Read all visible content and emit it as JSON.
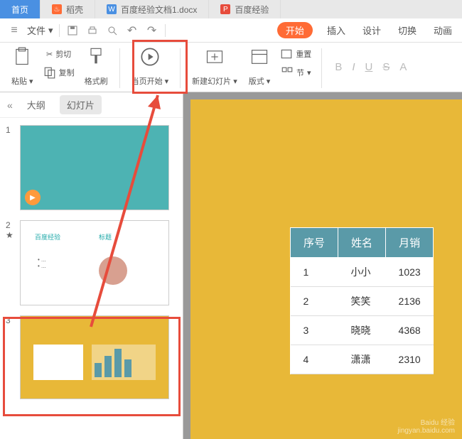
{
  "tabs": {
    "home": "首页",
    "daoke": "稻壳",
    "doc": "百度经验文档1.docx",
    "ppt": "百度经验"
  },
  "file_menu": "文件",
  "ribbon_menu": {
    "start": "开始",
    "insert": "插入",
    "design": "设计",
    "transition": "切换",
    "animation": "动画"
  },
  "ribbon": {
    "cut": "剪切",
    "paste": "粘贴",
    "copy": "复制",
    "format": "格式刷",
    "slideshow": "当页开始",
    "new_slide": "新建幻灯片",
    "layout": "版式",
    "section": "节",
    "reset": "重置"
  },
  "sidebar": {
    "outline": "大纲",
    "slides": "幻灯片"
  },
  "thumb_nums": [
    "1",
    "2",
    "3"
  ],
  "table": {
    "headers": [
      "序号",
      "姓名",
      "月销"
    ],
    "rows": [
      [
        "1",
        "小小",
        "1023"
      ],
      [
        "2",
        "笑笑",
        "2136"
      ],
      [
        "3",
        "晓晓",
        "4368"
      ],
      [
        "4",
        "潇潇",
        "2310"
      ]
    ]
  },
  "watermark": {
    "brand": "Baidu 经验",
    "url": "jingyan.baidu.com"
  }
}
